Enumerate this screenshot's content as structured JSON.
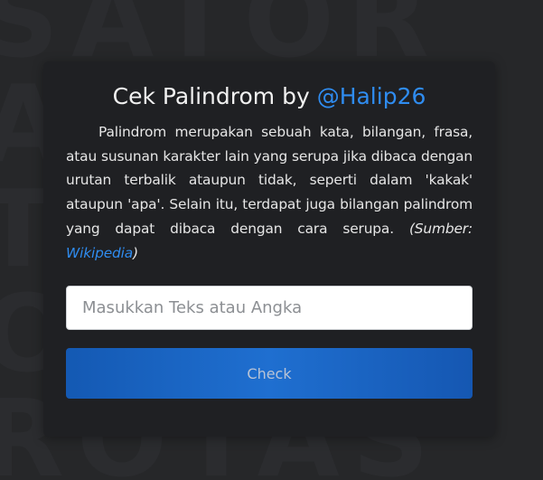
{
  "background": {
    "watermark_rows": [
      "SATOR",
      "AREPO",
      "TENET",
      "OPERA",
      "ROTAS"
    ]
  },
  "card": {
    "title_prefix": "Cek Palindrom by ",
    "title_handle": "@Halip26",
    "description": "Palindrom merupakan sebuah kata, bilangan, frasa, atau susunan karakter lain yang serupa jika dibaca dengan urutan terbalik ataupun tidak, seperti dalam 'kakak' ataupun 'apa'. Selain itu, terdapat juga bilangan palindrom yang dapat dibaca dengan cara serupa.",
    "source_open": "(Sumber: ",
    "source_link": "Wikipedia",
    "source_close": ")",
    "input_placeholder": "Masukkan Teks atau Angka",
    "input_value": "",
    "button_label": "Check"
  },
  "colors": {
    "page_background": "#262729",
    "card_background": "#1f2023",
    "accent": "#2f8cf0",
    "button": "#1a64c4"
  }
}
